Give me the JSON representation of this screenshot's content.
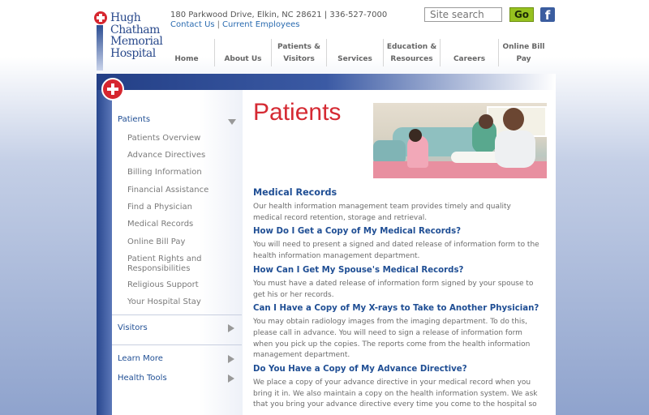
{
  "logo": {
    "line1": "Hugh",
    "line2": "Chatham",
    "line3": "Memorial",
    "line4": "Hospital"
  },
  "header": {
    "address": "180 Parkwood Drive, Elkin, NC 28621 | 336-527-7000",
    "contact_label": "Contact Us",
    "separator": "|",
    "employees_label": "Current Employees",
    "search_placeholder": "Site search",
    "go_label": "Go",
    "facebook_glyph": "f"
  },
  "nav": [
    {
      "label": "Home"
    },
    {
      "label": "About Us"
    },
    {
      "label": "Patients & Visitors"
    },
    {
      "label": "Services"
    },
    {
      "label": "Education & Resources"
    },
    {
      "label": "Careers"
    },
    {
      "label": "Online Bill Pay"
    }
  ],
  "sidebar": {
    "main": [
      {
        "label": "Patients"
      },
      {
        "label": "Visitors"
      },
      {
        "label": "Learn More"
      },
      {
        "label": "Health Tools"
      }
    ],
    "sub": [
      {
        "label": "Patients Overview"
      },
      {
        "label": "Advance Directives"
      },
      {
        "label": "Billing Information"
      },
      {
        "label": "Financial Assistance"
      },
      {
        "label": "Find a Physician"
      },
      {
        "label": "Medical Records"
      },
      {
        "label": "Online Bill Pay"
      },
      {
        "label": "Patient Rights and Responsibilities"
      },
      {
        "label": "Religious Support"
      },
      {
        "label": "Your Hospital Stay"
      }
    ]
  },
  "main": {
    "title": "Patients",
    "sections": [
      {
        "heading": "Medical Records",
        "body": "Our health information management team provides timely and quality medical record retention, storage and retrieval."
      },
      {
        "heading": "How Do I Get a Copy of My Medical Records?",
        "body": "You will need to present a signed and dated release of information form to the health information management department."
      },
      {
        "heading": "How Can I Get My Spouse's Medical Records?",
        "body": "You must have a dated release of information form signed by your spouse to get his or her records."
      },
      {
        "heading": "Can I Have a Copy of My X-rays to Take to Another Physician?",
        "body": "You may obtain radiology images from the imaging department. To do this, please call in advance. You will need to sign a release of information form when you pick up the copies. The reports come from the health information management department."
      },
      {
        "heading": "Do You Have a Copy of My Advance Directive?",
        "body": "We place a copy of your advance directive in your medical record when you bring it in. We also maintain a copy on the health information system. We ask that you bring your advance directive every time you come to the hospital so"
      }
    ]
  },
  "colors": {
    "brand_blue": "#1f4e94",
    "brand_red": "#d52a33",
    "go_green": "#96c11f"
  }
}
